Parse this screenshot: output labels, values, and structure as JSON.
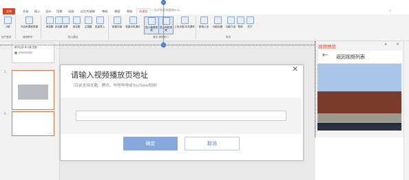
{
  "ribbon": {
    "tabs": [
      {
        "label": "文件"
      },
      {
        "label": "开始"
      },
      {
        "label": "插入"
      },
      {
        "label": "设计"
      },
      {
        "label": "切换"
      },
      {
        "label": "动画"
      },
      {
        "label": "幻灯片放映"
      },
      {
        "label": "审阅"
      },
      {
        "label": "视图"
      },
      {
        "label": "帮助"
      },
      {
        "label": "雨课堂"
      }
    ],
    "active_tab": "雨课堂",
    "tell_me": "告诉我您想要做什么",
    "user_icon": "user-icon",
    "buttons": [
      {
        "label": "小程"
      },
      {
        "label": "开启雨课堂授课"
      },
      {
        "label": "单选题"
      },
      {
        "label": "多选题"
      },
      {
        "label": "投票"
      },
      {
        "label": "填空题"
      },
      {
        "label": "主观题"
      },
      {
        "label": "批量导入"
      },
      {
        "label": "新建试卷"
      },
      {
        "label": "新建手机课件"
      },
      {
        "label": "插入幕课视频"
      },
      {
        "label": "插入网络视频"
      },
      {
        "label": "上传试卷/手机课件"
      },
      {
        "label": "新授公告"
      },
      {
        "label": "功能设置"
      },
      {
        "label": "功能介绍"
      },
      {
        "label": "帮助"
      },
      {
        "label": "关于"
      }
    ],
    "groups": [
      {
        "label": "用户登录"
      },
      {
        "label": "课堂教学"
      },
      {
        "label": "插入题目"
      },
      {
        "label": "课后·课前预习"
      },
      {
        "label": "更多"
      }
    ]
  },
  "thumbnails": [
    {
      "number": "",
      "text": "教学反馈 练习题 答题"
    },
    {
      "number": "5",
      "text": ""
    },
    {
      "number": "6",
      "text": ""
    }
  ],
  "preview_pane": {
    "title": "视频预览",
    "back_label": "返回视频列表"
  },
  "dialog": {
    "title": "请输入视频播放页地址",
    "subtitle": "（目前支持优酷、腾讯、哔哩哔哩或YouTube视频）",
    "input_value": "",
    "ok_label": "确定",
    "cancel_label": "取消"
  },
  "colors": {
    "accent": "#d24726",
    "primary_button": "#86a8dc",
    "guide": "#2a5ea8"
  }
}
